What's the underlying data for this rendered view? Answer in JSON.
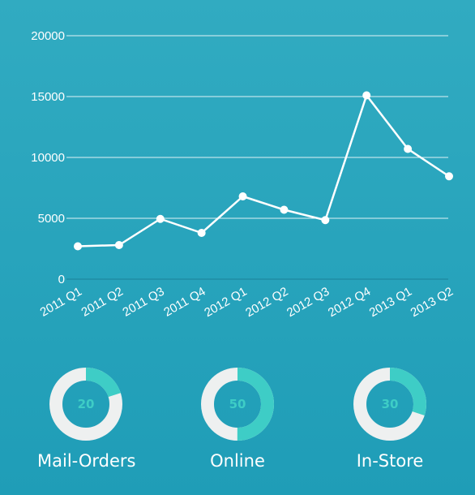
{
  "chart_data": {
    "type": "line",
    "categories": [
      "2011 Q1",
      "2011 Q2",
      "2011 Q3",
      "2011 Q4",
      "2012 Q1",
      "2012 Q2",
      "2012 Q3",
      "2012 Q4",
      "2013 Q1",
      "2013 Q2"
    ],
    "series": [
      {
        "values": [
          2700,
          2800,
          4950,
          3800,
          6800,
          5700,
          4850,
          15100,
          10700,
          8450
        ]
      }
    ],
    "yticks": [
      0,
      5000,
      10000,
      15000,
      20000
    ],
    "ylim": [
      0,
      20000
    ],
    "grid": true,
    "title": "",
    "xlabel": "",
    "ylabel": ""
  },
  "donuts": [
    {
      "label": "Mail-Orders",
      "value": "20",
      "percent": 20
    },
    {
      "label": "Online",
      "value": "50",
      "percent": 50
    },
    {
      "label": "In-Store",
      "value": "30",
      "percent": 30
    }
  ],
  "colors": {
    "line": "#ffffff",
    "grid": "#ffffff",
    "donut_fill": "#3ecdc6",
    "donut_track": "#eef0f0",
    "donut_text": "#3ecdc6"
  }
}
